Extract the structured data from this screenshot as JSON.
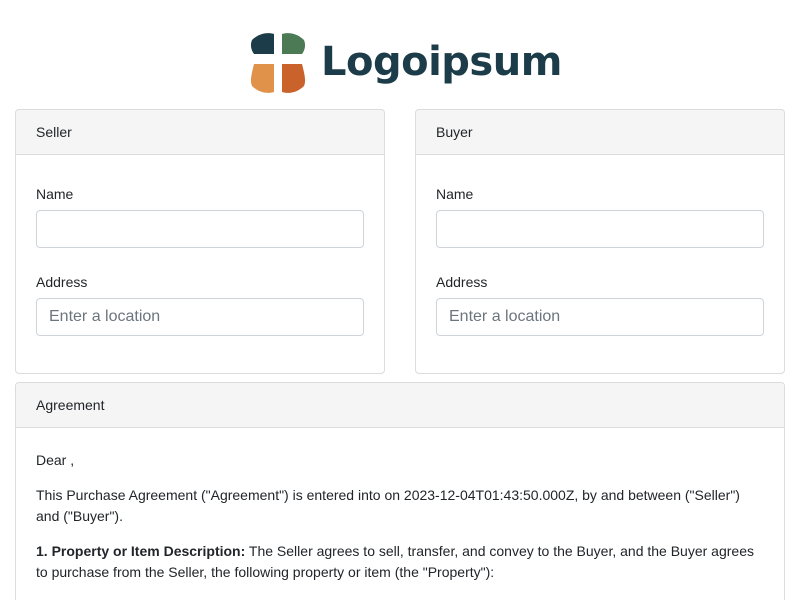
{
  "brand": {
    "name": "Logoipsum",
    "colors": {
      "petal_top_left": "#1b3c48",
      "petal_top_right": "#4b7a54",
      "petal_bottom_left": "#e0914a",
      "petal_bottom_right": "#c9622b",
      "text": "#1b3c48"
    }
  },
  "seller": {
    "title": "Seller",
    "name_label": "Name",
    "name_value": "",
    "address_label": "Address",
    "address_placeholder": "Enter a location"
  },
  "buyer": {
    "title": "Buyer",
    "name_label": "Name",
    "name_value": "",
    "address_label": "Address",
    "address_placeholder": "Enter a location"
  },
  "agreement": {
    "title": "Agreement",
    "greeting": "Dear ,",
    "intro": "This Purchase Agreement (\"Agreement\") is entered into on 2023-12-04T01:43:50.000Z, by and between (\"Seller\") and (\"Buyer\").",
    "section1_heading": "1. Property or Item Description:",
    "section1_text": " The Seller agrees to sell, transfer, and convey to the Buyer, and the Buyer agrees to purchase from the Seller, the following property or item (the \"Property\"):"
  }
}
